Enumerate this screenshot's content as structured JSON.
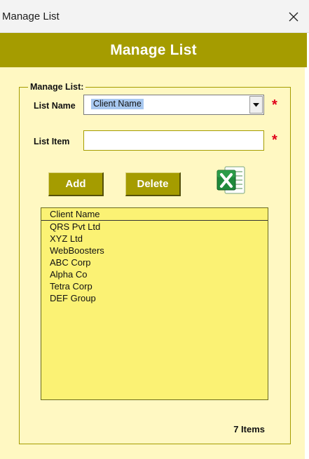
{
  "window": {
    "title": "Manage List"
  },
  "banner": {
    "title": "Manage List"
  },
  "group": {
    "legend": "Manage List:",
    "list_name_label": "List Name",
    "list_name_value": "Client Name",
    "list_item_label": "List Item",
    "list_item_value": "",
    "required_mark": "*"
  },
  "buttons": {
    "add": "Add",
    "delete": "Delete"
  },
  "list": {
    "header": "Client Name",
    "items": [
      "QRS Pvt Ltd",
      "XYZ Ltd",
      "WebBoosters",
      "ABC Corp",
      "Alpha Co",
      "Tetra Corp",
      "DEF Group"
    ]
  },
  "count_label": "7 Items",
  "icons": {
    "close": "close-icon",
    "dropdown": "chevron-down-icon",
    "excel": "excel-icon"
  },
  "colors": {
    "accent": "#a59c00",
    "background": "#fff8c2",
    "list_background": "#fbf274",
    "required": "#e0001b"
  }
}
